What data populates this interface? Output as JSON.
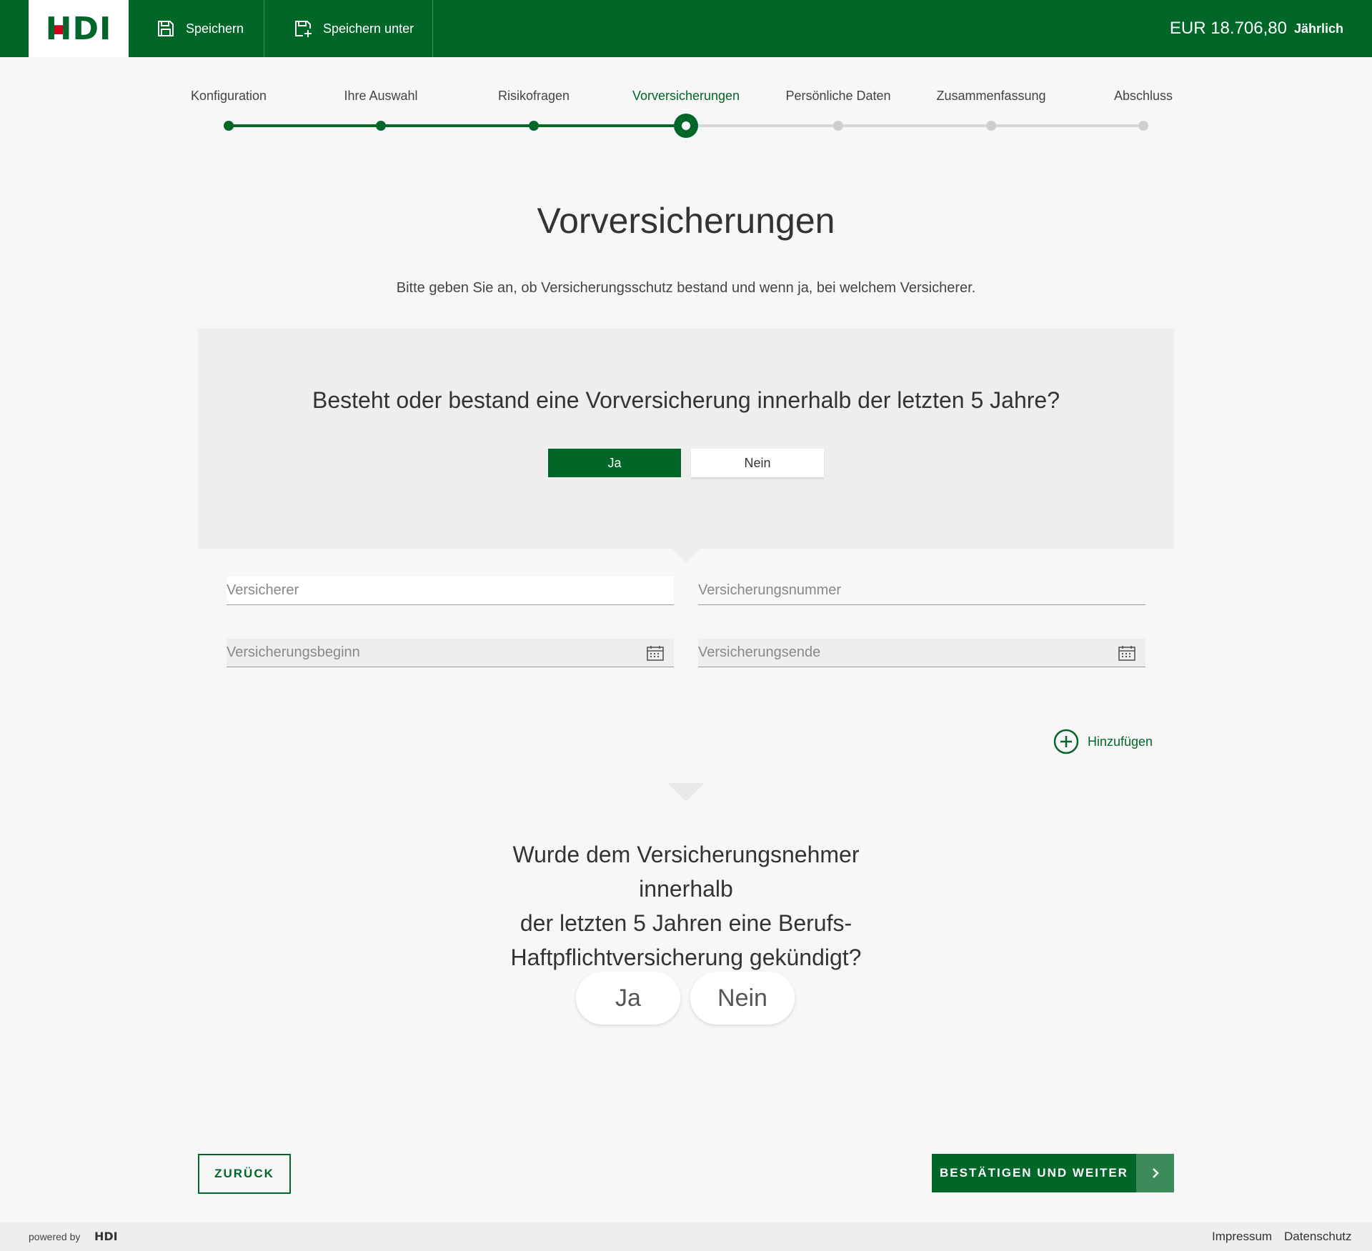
{
  "header": {
    "logo": "HDI",
    "save_label": "Speichern",
    "save_as_label": "Speichern unter",
    "premium_amount": "EUR 18.706,80",
    "premium_period": "Jährlich"
  },
  "stepper": {
    "steps": [
      {
        "label": "Konfiguration",
        "state": "done"
      },
      {
        "label": "Ihre Auswahl",
        "state": "done"
      },
      {
        "label": "Risikofragen",
        "state": "done"
      },
      {
        "label": "Vorversicherungen",
        "state": "active"
      },
      {
        "label": "Persönliche Daten",
        "state": "todo"
      },
      {
        "label": "Zusammenfassung",
        "state": "todo"
      },
      {
        "label": "Abschluss",
        "state": "todo"
      }
    ]
  },
  "page": {
    "title": "Vorversicherungen",
    "subtitle": "Bitte geben Sie an, ob Versicherungsschutz bestand und wenn ja, bei welchem Versicherer."
  },
  "question1": {
    "text": "Besteht oder bestand eine Vorversicherung innerhalb der letzten 5 Jahre?",
    "yes_label": "Ja",
    "no_label": "Nein",
    "selected": "Ja"
  },
  "form": {
    "insurer_placeholder": "Versicherer",
    "policy_number_placeholder": "Versicherungsnummer",
    "start_placeholder": "Versicherungsbeginn",
    "end_placeholder": "Versicherungsende",
    "add_label": "Hinzufügen"
  },
  "question2": {
    "line1": "Wurde dem Versicherungsnehmer innerhalb",
    "line2": "der letzten 5 Jahren eine Berufs-",
    "line3": "Haftpflichtversicherung gekündigt?",
    "yes_label": "Ja",
    "no_label": "Nein"
  },
  "nav": {
    "back_label": "ZURÜCK",
    "next_label": "BESTÄTIGEN UND WEITER"
  },
  "footer": {
    "powered_by": "powered by",
    "logo": "HDI",
    "impressum": "Impressum",
    "datenschutz": "Datenschutz"
  },
  "colors": {
    "brand_green": "#006729",
    "panel_grey": "#eeeeee",
    "page_bg": "#f7f7f7"
  },
  "icons": {
    "save": "save-icon",
    "save_as": "save-as-icon",
    "calendar": "calendar-icon",
    "add": "plus-circle-icon",
    "next": "chevron-right-icon"
  }
}
